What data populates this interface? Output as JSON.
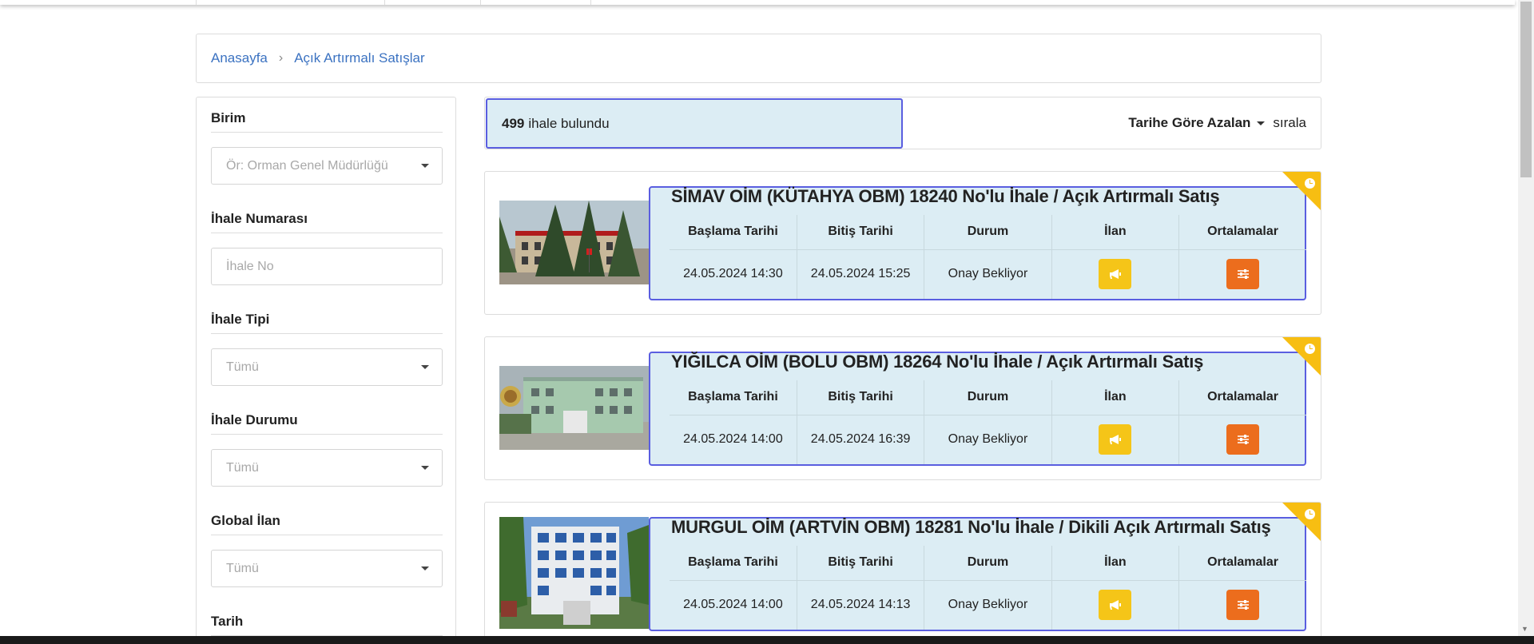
{
  "breadcrumb": {
    "home": "Anasayfa",
    "current": "Açık Artırmalı Satışlar"
  },
  "filters": {
    "birim": {
      "label": "Birim",
      "placeholder": "Ör: Orman Genel Müdürlüğü"
    },
    "ihale_no": {
      "label": "İhale Numarası",
      "placeholder": "İhale No"
    },
    "ihale_tipi": {
      "label": "İhale Tipi",
      "value": "Tümü"
    },
    "ihale_durumu": {
      "label": "İhale Durumu",
      "value": "Tümü"
    },
    "global_ilan": {
      "label": "Global İlan",
      "value": "Tümü"
    },
    "tarih": {
      "label": "Tarih"
    }
  },
  "results": {
    "count": "499",
    "count_suffix": "ihale bulundu",
    "sort_value": "Tarihe Göre Azalan",
    "sort_suffix": "sırala"
  },
  "columns": [
    "Başlama Tarihi",
    "Bitiş Tarihi",
    "Durum",
    "İlan",
    "Ortalamalar"
  ],
  "tenders": [
    {
      "title": "SİMAV OİM (KÜTAHYA OBM) 18240 No'lu İhale / Açık Artırmalı Satış",
      "start": "24.05.2024 14:30",
      "end": "24.05.2024 15:25",
      "status": "Onay Bekliyor"
    },
    {
      "title": "YIĞILCA OİM (BOLU OBM) 18264 No'lu İhale / Açık Artırmalı Satış",
      "start": "24.05.2024 14:00",
      "end": "24.05.2024 16:39",
      "status": "Onay Bekliyor"
    },
    {
      "title": "MURGUL OİM (ARTVİN OBM) 18281 No'lu İhale / Dikili Açık Artırmalı Satış",
      "start": "24.05.2024 14:00",
      "end": "24.05.2024 14:13",
      "status": "Onay Bekliyor"
    }
  ],
  "icons": {
    "ilan": "megaphone-icon",
    "ortalamalar": "sliders-icon",
    "corner": "clock-icon"
  },
  "colors": {
    "link": "#3b72c1",
    "panel_bg": "#dcedf4",
    "panel_border": "#5a5ee0",
    "ilan_button": "#f5c518",
    "ortalamalar_button": "#ec6d1d",
    "corner_ribbon": "#f7be12"
  }
}
